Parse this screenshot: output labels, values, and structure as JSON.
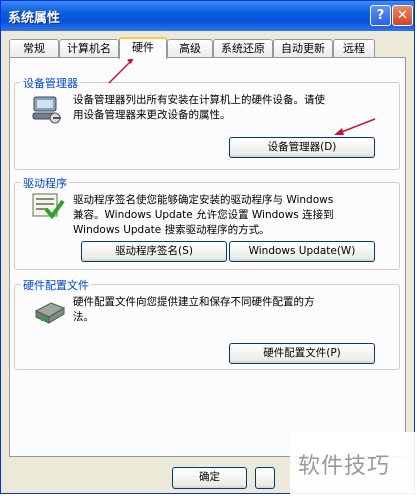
{
  "window": {
    "title": "系统属性",
    "help_label": "?",
    "close_label": "✕"
  },
  "tabs": [
    {
      "label": "常规"
    },
    {
      "label": "计算机名"
    },
    {
      "label": "硬件"
    },
    {
      "label": "高级"
    },
    {
      "label": "系统还原"
    },
    {
      "label": "自动更新"
    },
    {
      "label": "远程"
    }
  ],
  "active_tab": "硬件",
  "groups": {
    "device_manager": {
      "title": "设备管理器",
      "icon": "device-manager-icon",
      "description_line1": "设备管理器列出所有安装在计算机上的硬件设备。请使",
      "description_line2": "用设备管理器来更改设备的属性。",
      "button_label": "设备管理器(D)"
    },
    "drivers": {
      "title": "驱动程序",
      "icon": "driver-signing-icon",
      "description_line1": "驱动程序签名使您能够确定安装的驱动程序与 Windows",
      "description_line2": "兼容。Windows Update 允许您设置 Windows 连接到",
      "description_line3": "Windows Update 搜索驱动程序的方式。",
      "signing_button_label": "驱动程序签名(S)",
      "update_button_label": "Windows Update(W)"
    },
    "hardware_profiles": {
      "title": "硬件配置文件",
      "icon": "hardware-profile-icon",
      "description_line1": "硬件配置文件向您提供建立和保存不同硬件配置的方",
      "description_line2": "法。",
      "button_label": "硬件配置文件(P)"
    }
  },
  "footer": {
    "ok_label": "确定",
    "apply_label": ""
  },
  "watermark": {
    "text": "软件技巧"
  },
  "colors": {
    "title_bar": "#0855dd",
    "group_title": "#0046d5",
    "arrow": "#cc1133",
    "tab_highlight": "#ffc83c"
  }
}
